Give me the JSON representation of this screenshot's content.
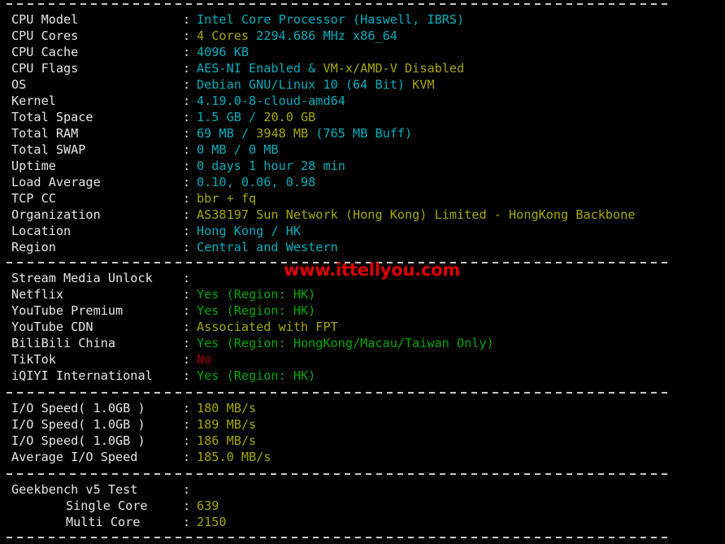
{
  "terminal": {
    "watermark": "www.ittellyou.com",
    "colors": {
      "background": "#000000",
      "label": "#e6e6e6",
      "cyan": "#00aebd",
      "yellow": "#a6a600",
      "green": "#00a800",
      "red": "#a80000",
      "separator": "#c8c8c8"
    },
    "separator_char": "-"
  },
  "sections": [
    {
      "name": "system-info",
      "rows": [
        {
          "label": "CPU Model",
          "segments": [
            {
              "text": "Intel Core Processor (Haswell, IBRS)",
              "color": "cyan"
            }
          ]
        },
        {
          "label": "CPU Cores",
          "segments": [
            {
              "text": "4 Cores ",
              "color": "yellow"
            },
            {
              "text": "2294.686 MHz ",
              "color": "cyan"
            },
            {
              "text": "x86_64",
              "color": "cyan"
            }
          ]
        },
        {
          "label": "CPU Cache",
          "segments": [
            {
              "text": "4096 KB",
              "color": "cyan"
            }
          ]
        },
        {
          "label": "CPU Flags",
          "segments": [
            {
              "text": "AES-NI Enabled ",
              "color": "cyan"
            },
            {
              "text": "& ",
              "color": "cyan"
            },
            {
              "text": "VM-x/AMD-V Disabled",
              "color": "yellow"
            }
          ]
        },
        {
          "label": "OS",
          "segments": [
            {
              "text": "Debian GNU/Linux 10 (64 Bit) ",
              "color": "cyan"
            },
            {
              "text": "KVM",
              "color": "yellow"
            }
          ]
        },
        {
          "label": "Kernel",
          "segments": [
            {
              "text": "4.19.0-8-cloud-amd64",
              "color": "cyan"
            }
          ]
        },
        {
          "label": "Total Space",
          "segments": [
            {
              "text": "1.5 GB ",
              "color": "cyan"
            },
            {
              "text": "/ ",
              "color": "cyan"
            },
            {
              "text": "20.0 GB",
              "color": "yellow"
            }
          ]
        },
        {
          "label": "Total RAM",
          "segments": [
            {
              "text": "69 MB ",
              "color": "cyan"
            },
            {
              "text": "/ ",
              "color": "cyan"
            },
            {
              "text": "3948 MB ",
              "color": "yellow"
            },
            {
              "text": "(765 MB Buff)",
              "color": "cyan"
            }
          ]
        },
        {
          "label": "Total SWAP",
          "segments": [
            {
              "text": "0 MB / 0 MB",
              "color": "cyan"
            }
          ]
        },
        {
          "label": "Uptime",
          "segments": [
            {
              "text": "0 days 1 hour 28 min",
              "color": "cyan"
            }
          ]
        },
        {
          "label": "Load Average",
          "segments": [
            {
              "text": "0.10, 0.06, 0.98",
              "color": "cyan"
            }
          ]
        },
        {
          "label": "TCP CC",
          "segments": [
            {
              "text": "bbr + fq",
              "color": "yellow"
            }
          ]
        },
        {
          "label": "Organization",
          "segments": [
            {
              "text": "AS38197 Sun Network (Hong Kong) Limited - HongKong Backbone",
              "color": "yellow"
            }
          ]
        },
        {
          "label": "Location",
          "segments": [
            {
              "text": "Hong Kong / HK",
              "color": "cyan"
            }
          ]
        },
        {
          "label": "Region",
          "segments": [
            {
              "text": "Central and Western",
              "color": "cyan"
            }
          ]
        }
      ]
    },
    {
      "name": "stream-media-unlock",
      "rows": [
        {
          "label": "Stream Media Unlock",
          "segments": []
        },
        {
          "label": "Netflix",
          "segments": [
            {
              "text": "Yes (Region: HK)",
              "color": "green"
            }
          ]
        },
        {
          "label": "YouTube Premium",
          "segments": [
            {
              "text": "Yes (Region: HK)",
              "color": "green"
            }
          ]
        },
        {
          "label": "YouTube CDN",
          "segments": [
            {
              "text": "Associated with FPT",
              "color": "yellow"
            }
          ]
        },
        {
          "label": "BiliBili China",
          "segments": [
            {
              "text": "Yes (Region: HongKong/Macau/Taiwan Only)",
              "color": "green"
            }
          ]
        },
        {
          "label": "TikTok",
          "segments": [
            {
              "text": "No",
              "color": "red"
            }
          ]
        },
        {
          "label": "iQIYI International",
          "segments": [
            {
              "text": "Yes (Region: HK)",
              "color": "green"
            }
          ]
        }
      ]
    },
    {
      "name": "io-speed",
      "rows": [
        {
          "label": "I/O Speed( 1.0GB )",
          "segments": [
            {
              "text": "180 MB/s",
              "color": "yellow"
            }
          ]
        },
        {
          "label": "I/O Speed( 1.0GB )",
          "segments": [
            {
              "text": "189 MB/s",
              "color": "yellow"
            }
          ]
        },
        {
          "label": "I/O Speed( 1.0GB )",
          "segments": [
            {
              "text": "186 MB/s",
              "color": "yellow"
            }
          ]
        },
        {
          "label": "Average I/O Speed",
          "segments": [
            {
              "text": "185.0 MB/s",
              "color": "yellow"
            }
          ]
        }
      ]
    },
    {
      "name": "geekbench",
      "rows": [
        {
          "label": "Geekbench v5 Test",
          "segments": []
        },
        {
          "label": "Single Core",
          "indent": true,
          "segments": [
            {
              "text": "639",
              "color": "yellow"
            }
          ]
        },
        {
          "label": "Multi Core",
          "indent": true,
          "segments": [
            {
              "text": "2150",
              "color": "yellow"
            }
          ]
        }
      ]
    }
  ]
}
